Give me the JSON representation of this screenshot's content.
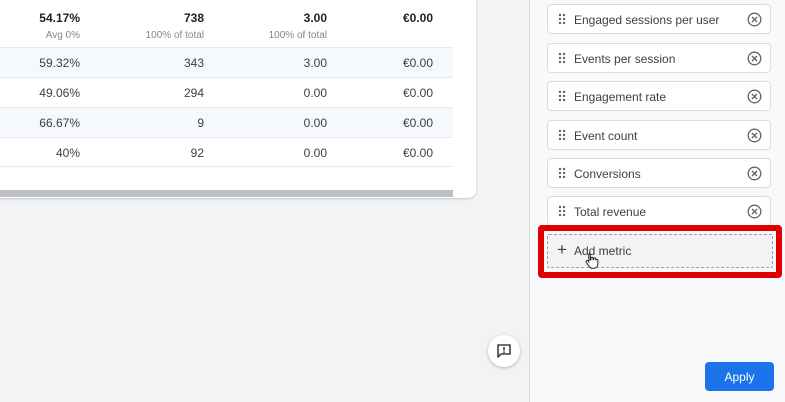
{
  "table": {
    "totals": [
      {
        "value": "54.17%",
        "sub": "Avg 0%"
      },
      {
        "value": "738",
        "sub": "100% of total"
      },
      {
        "value": "3.00",
        "sub": "100% of total"
      },
      {
        "value": "€0.00",
        "sub": ""
      }
    ],
    "rows": [
      [
        "59.32%",
        "343",
        "3.00",
        "€0.00"
      ],
      [
        "49.06%",
        "294",
        "0.00",
        "€0.00"
      ],
      [
        "66.67%",
        "9",
        "0.00",
        "€0.00"
      ],
      [
        "40%",
        "92",
        "0.00",
        "€0.00"
      ]
    ]
  },
  "panel": {
    "metrics": [
      {
        "label": "Engaged sessions per user"
      },
      {
        "label": "Events per session"
      },
      {
        "label": "Engagement rate"
      },
      {
        "label": "Event count"
      },
      {
        "label": "Conversions"
      },
      {
        "label": "Total revenue"
      }
    ],
    "add_metric_label": "Add metric",
    "apply_label": "Apply"
  },
  "colors": {
    "accent": "#1a73e8",
    "highlight": "#e00000"
  }
}
